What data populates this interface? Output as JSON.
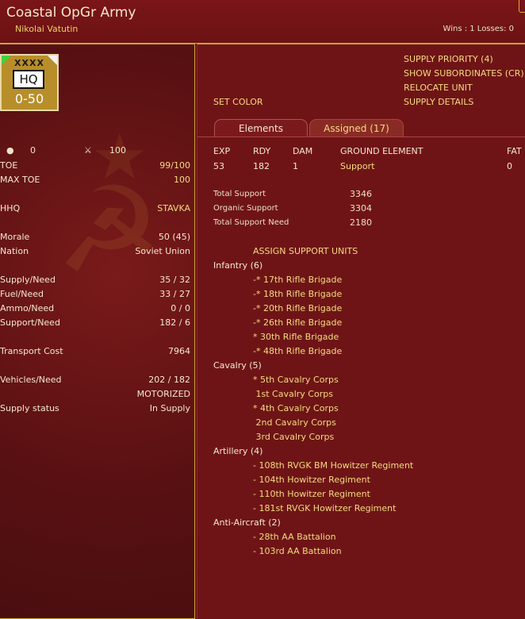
{
  "header": {
    "unit_name": "Coastal OpGr Army",
    "commander": "Nikolai Vatutin",
    "record": "Wins : 1  Losses: 0"
  },
  "counter": {
    "size": "XXXX",
    "type": "HQ",
    "strength": "0-50"
  },
  "summary": {
    "left_value": "0",
    "right_value": "100"
  },
  "stats": [
    {
      "label": "TOE",
      "value": "99/100"
    },
    {
      "label": "MAX TOE",
      "value": "100"
    },
    {
      "label": "HHQ",
      "value": "STAVKA"
    },
    {
      "label": "Morale",
      "value": "50 (45)"
    },
    {
      "label": "Nation",
      "value": "Soviet Union"
    },
    {
      "label": "Supply/Need",
      "value": "35 / 32"
    },
    {
      "label": "Fuel/Need",
      "value": "33 / 27"
    },
    {
      "label": "Ammo/Need",
      "value": "0 / 0"
    },
    {
      "label": "Support/Need",
      "value": "182 / 6"
    },
    {
      "label": "Transport Cost",
      "value": "7964"
    },
    {
      "label": "Vehicles/Need",
      "value": "202 / 182"
    },
    {
      "label": "",
      "value": "MOTORIZED"
    },
    {
      "label": "Supply status",
      "value": "In Supply"
    }
  ],
  "actions": {
    "set_color": "SET COLOR",
    "supply_priority": "SUPPLY PRIORITY (4)",
    "show_subordinates": "SHOW SUBORDINATES (CR)",
    "relocate_unit": "RELOCATE UNIT",
    "supply_details": "SUPPLY DETAILS"
  },
  "tabs": {
    "elements": "Elements",
    "assigned": "Assigned (17)"
  },
  "elements_table": {
    "headers": [
      "EXP",
      "RDY",
      "DAM",
      "GROUND ELEMENT",
      "FAT"
    ],
    "rows": [
      {
        "exp": "53",
        "rdy": "182",
        "dam": "1",
        "element": "Support",
        "fat": "0"
      }
    ]
  },
  "support_totals": [
    {
      "label": "Total Support",
      "value": "3346"
    },
    {
      "label": "Organic Support",
      "value": "3304"
    },
    {
      "label": "Total Support Need",
      "value": "2180"
    }
  ],
  "assign_title": "ASSIGN SUPPORT UNITS",
  "categories": [
    {
      "name": "Infantry (6)",
      "units": [
        "-* 17th Rifle Brigade",
        "-* 18th Rifle Brigade",
        "-* 20th Rifle Brigade",
        "-* 26th Rifle Brigade",
        "* 30th Rifle Brigade",
        "-* 48th Rifle Brigade"
      ]
    },
    {
      "name": "Cavalry (5)",
      "units": [
        "* 5th Cavalry Corps",
        " 1st Cavalry Corps",
        "* 4th Cavalry Corps",
        " 2nd Cavalry Corps",
        " 3rd Cavalry Corps"
      ]
    },
    {
      "name": "Artillery (4)",
      "units": [
        "- 108th RVGK BM Howitzer Regiment",
        "- 104th Howitzer Regiment",
        "- 110th Howitzer Regiment",
        "- 181st RVGK Howitzer Regiment"
      ]
    },
    {
      "name": "Anti-Aircraft (2)",
      "units": [
        "- 28th AA Battalion",
        "- 103rd AA Battalion"
      ]
    }
  ],
  "colors": {
    "background": "#6f1416",
    "accent": "#c9a63a",
    "highlight_text": "#f2dc80",
    "counter_fill": "#b88e2a"
  }
}
